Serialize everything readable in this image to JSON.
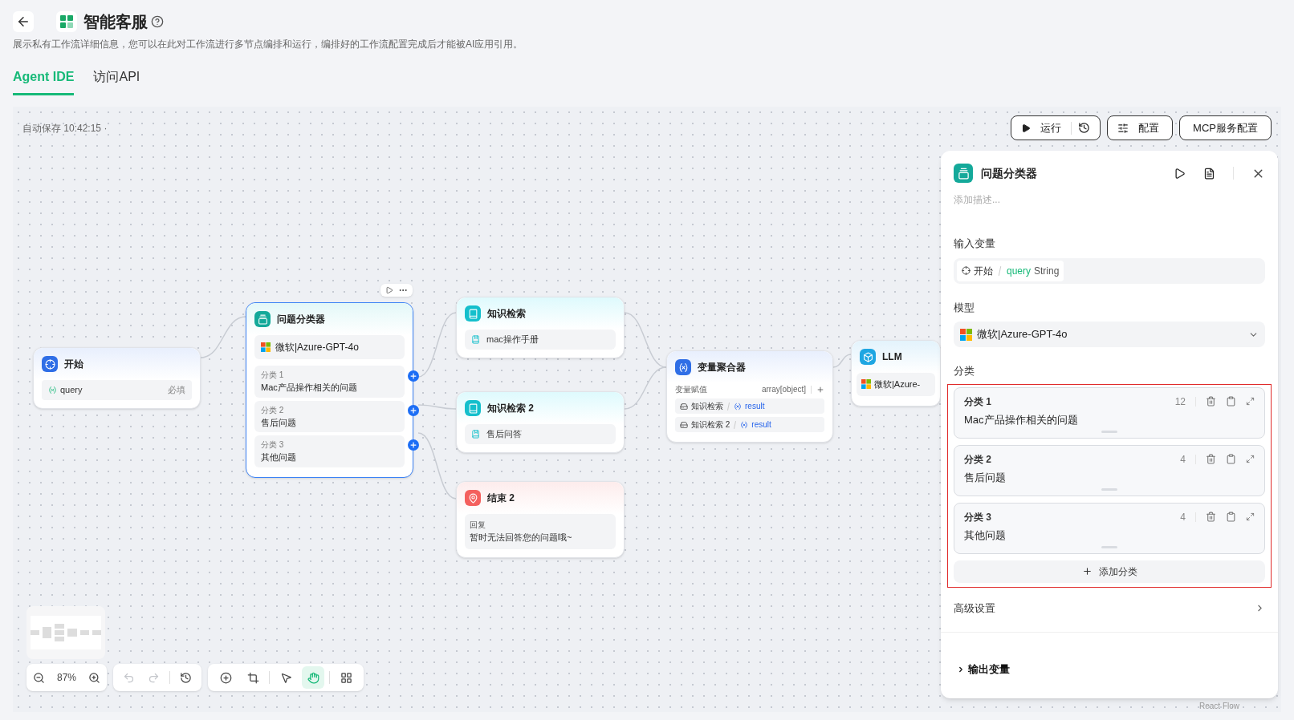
{
  "header": {
    "title": "智能客服",
    "description": "展示私有工作流详细信息，您可以在此对工作流进行多节点编排和运行，编排好的工作流配置完成后才能被AI应用引用。"
  },
  "tabs": [
    {
      "label": "Agent IDE",
      "selected": true
    },
    {
      "label": "访问API",
      "selected": false
    }
  ],
  "canvas": {
    "autosave": "自动保存 10:42:15 ·",
    "actions": [
      {
        "kind": "run",
        "label": "运行"
      },
      {
        "kind": "config",
        "label": "配置"
      },
      {
        "kind": "mcp",
        "label": "MCP服务配置"
      }
    ],
    "nodes": [
      {
        "kind": "start",
        "title": "开始",
        "selected": false,
        "fields": [
          {
            "name": "query",
            "tag": "必填"
          }
        ]
      },
      {
        "kind": "classifier",
        "title": "问题分类器",
        "selected": true,
        "model": "微软|Azure-GPT-4o",
        "classes": [
          {
            "label": "分类 1",
            "text": "Mac产品操作相关的问题"
          },
          {
            "label": "分类 2",
            "text": "售后问题"
          },
          {
            "label": "分类 3",
            "text": "其他问题"
          }
        ]
      },
      {
        "kind": "knowledge",
        "title": "知识检索",
        "selected": false,
        "items": [
          "mac操作手册"
        ]
      },
      {
        "kind": "knowledge",
        "title": "知识检索 2",
        "selected": false,
        "items": [
          "售后问答"
        ]
      },
      {
        "kind": "end",
        "title": "结束 2",
        "selected": false,
        "reply_label": "回复",
        "reply": "暂时无法回答您的问题哦~"
      },
      {
        "kind": "aggregator",
        "title": "变量聚合器",
        "selected": false,
        "label": "变量赋值",
        "type": "array[object]",
        "vars": [
          {
            "source": "知识检索",
            "name": "result"
          },
          {
            "source": "知识检索 2",
            "name": "result"
          }
        ]
      },
      {
        "kind": "llm",
        "title": "LLM",
        "selected": false,
        "model": "微软|Azure-"
      }
    ],
    "zoom": "87%",
    "history_buttons": [
      {
        "kind": "undo",
        "disabled": true
      },
      {
        "kind": "redo",
        "disabled": true
      },
      {
        "kind": "history",
        "disabled": false
      }
    ],
    "tools": [
      {
        "kind": "add",
        "selected": false
      },
      {
        "kind": "crop",
        "selected": false
      },
      {
        "kind": "pointer",
        "selected": false
      },
      {
        "kind": "hand",
        "selected": true
      },
      {
        "kind": "layout",
        "selected": false
      }
    ],
    "attribution": "React Flow"
  },
  "panel": {
    "title": "问题分类器",
    "description_placeholder": "添加描述...",
    "input_label": "输入变量",
    "input": {
      "node": "开始",
      "var": "query",
      "type": "String"
    },
    "model_label": "模型",
    "model": "微软|Azure-GPT-4o",
    "classes_label": "分类",
    "classes": [
      {
        "label": "分类 1",
        "text": "Mac产品操作相关的问题",
        "count": "12"
      },
      {
        "label": "分类 2",
        "text": "售后问题",
        "count": "4"
      },
      {
        "label": "分类 3",
        "text": "其他问题",
        "count": "4"
      }
    ],
    "add_label": "添加分类",
    "advanced_label": "高级设置",
    "output_label": "输出变量"
  }
}
